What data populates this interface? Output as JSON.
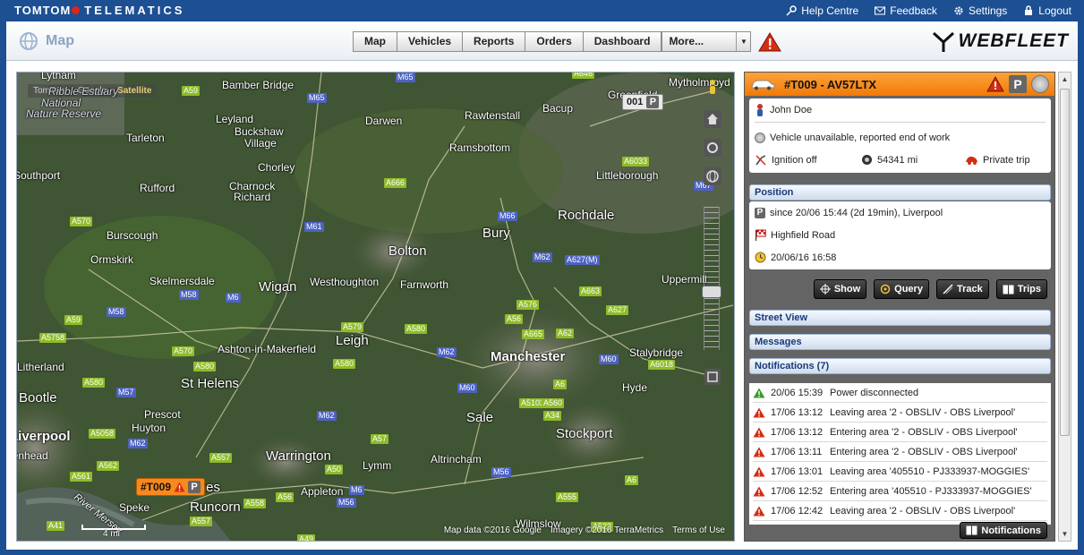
{
  "brand": {
    "tomtom": "TOMTOM",
    "telematics": "TELEMATICS"
  },
  "toplinks": {
    "help": "Help Centre",
    "feedback": "Feedback",
    "settings": "Settings",
    "logout": "Logout"
  },
  "page": {
    "title": "Map"
  },
  "nav": {
    "map": "Map",
    "vehicles": "Vehicles",
    "reports": "Reports",
    "orders": "Orders",
    "dashboard": "Dashboard",
    "more": "More..."
  },
  "logo": {
    "text": "WEBFLEET"
  },
  "map": {
    "type_tomtom": "TomTom",
    "type_google": "Google",
    "type_satellite": "Satellite",
    "vehicle_marker": "#T009",
    "marker_001": "001",
    "parking_letter": "P",
    "scale": "4 mi",
    "attribution_data": "Map data ©2016 Google",
    "attribution_imagery": "Imagery ©2016 TerraMetrics",
    "terms": "Terms of Use",
    "places": {
      "lytham": "Lytham",
      "ribble": "Ribble Estuary",
      "national": "National",
      "nature": "Nature Reserve",
      "bamber": "Bamber Bridge",
      "darwen": "Darwen",
      "rawtenstall": "Rawtenstall",
      "bacup": "Bacup",
      "mytholmroyd": "Mytholmroyd",
      "leyland": "Leyland",
      "buckshaw": "Buckshaw",
      "village": "Village",
      "tarleton": "Tarleton",
      "chorley": "Chorley",
      "ramsbottom": "Ramsbottom",
      "littleborough": "Littleborough",
      "southport": "Southport",
      "rufford": "Rufford",
      "charnock": "Charnock",
      "richard": "Richard",
      "rochdale": "Rochdale",
      "burscough": "Burscough",
      "bury": "Bury",
      "bolton": "Bolton",
      "ormskirk": "Ormskirk",
      "skelmersdale": "Skelmersdale",
      "wigan": "Wigan",
      "westhoughton": "Westhoughton",
      "farnworth": "Farnworth",
      "uppermill": "Uppermill",
      "leigh": "Leigh",
      "ashton": "Ashton-in-Makerfield",
      "manchester": "Manchester",
      "stalybridge": "Stalybridge",
      "litherland": "Litherland",
      "sthelens": "St Helens",
      "bootle": "Bootle",
      "hyde": "Hyde",
      "prescot": "Prescot",
      "liverpool": "Liverpool",
      "huyton": "Huyton",
      "sale": "Sale",
      "stockport": "Stockport",
      "birkenhead": "Birkenhead",
      "warrington": "Warrington",
      "lymm": "Lymm",
      "altrincham": "Altrincham",
      "widnes": "Widnes",
      "appleton": "Appleton",
      "runcorn": "Runcorn",
      "speke": "Speke",
      "wilmslow": "Wilmslow",
      "rivermersey": "River Mersey",
      "greenfield": "Greenfield"
    },
    "roads": {
      "m65a": "M65",
      "m65b": "M65",
      "a59a": "A59",
      "a646": "A646",
      "a666": "A666",
      "a6033": "A6033",
      "m66": "M66",
      "m61": "M61",
      "a570a": "A570",
      "m62a": "M62",
      "a627": "A627(M)",
      "m58a": "M58",
      "m6a": "M6",
      "m58b": "M58",
      "a59b": "A59",
      "a579": "A579",
      "a580a": "A580",
      "a576": "A576",
      "a663": "A663",
      "a5758": "A5758",
      "a570b": "A570",
      "a56": "A56",
      "a627b": "A627",
      "a665": "A665",
      "a62": "A62",
      "m62b": "M62",
      "m60a": "M60",
      "a580b": "A580",
      "a580c": "A580",
      "a6018": "A6018",
      "a580d": "A580",
      "m57": "M57",
      "m60b": "M60",
      "a6": "A6",
      "a5103": "A5103",
      "a560": "A560",
      "a34": "A34",
      "a5058": "A5058",
      "m62c": "M62",
      "m62d": "M62",
      "a57": "A57",
      "a562": "A562",
      "a557": "A557",
      "m56a": "M56",
      "a561": "A561",
      "a50": "A50",
      "m6b": "M6",
      "a6b": "A6",
      "a56b": "A56",
      "a558": "A558",
      "m56b": "M56",
      "a555": "A555",
      "a557b": "A557",
      "a41": "A41",
      "a49": "A49",
      "a523": "A523",
      "m67": "M67"
    }
  },
  "vehicle": {
    "id": "#T009 - AV57LTX",
    "driver": "John Doe",
    "status": "Vehicle unavailable, reported end of work",
    "ignition": "Ignition off",
    "odometer": "54341 mi",
    "trip": "Private trip"
  },
  "sections": {
    "position": "Position",
    "street_view": "Street View",
    "messages": "Messages",
    "notifications": "Notifications (7)"
  },
  "position": {
    "parked": "since 20/06 15:44 (2d 19min), Liverpool",
    "street": "Highfield Road",
    "time": "20/06/16 16:58"
  },
  "tools": {
    "show": "Show",
    "query": "Query",
    "track": "Track",
    "trips": "Trips"
  },
  "notifications": [
    {
      "time": "20/06 15:39",
      "text": "Power disconnected",
      "level": "green"
    },
    {
      "time": "17/06 13:12",
      "text": "Leaving area '2 - OBSLIV - OBS Liverpool'",
      "level": "red"
    },
    {
      "time": "17/06 13:12",
      "text": "Entering area '2 - OBSLIV - OBS Liverpool'",
      "level": "red"
    },
    {
      "time": "17/06 13:11",
      "text": "Entering area '2 - OBSLIV - OBS Liverpool'",
      "level": "red"
    },
    {
      "time": "17/06 13:01",
      "text": "Leaving area '405510 - PJ333937-MOGGIES'",
      "level": "red"
    },
    {
      "time": "17/06 12:52",
      "text": "Entering area '405510 - PJ333937-MOGGIES'",
      "level": "red"
    },
    {
      "time": "17/06 12:42",
      "text": "Leaving area '2 - OBSLIV - OBS Liverpool'",
      "level": "red"
    }
  ],
  "notifications_button": "Notifications",
  "colors": {
    "brand_blue": "#1d4f93",
    "vehicle_orange": "#f17a07",
    "section_text": "#17397a"
  }
}
